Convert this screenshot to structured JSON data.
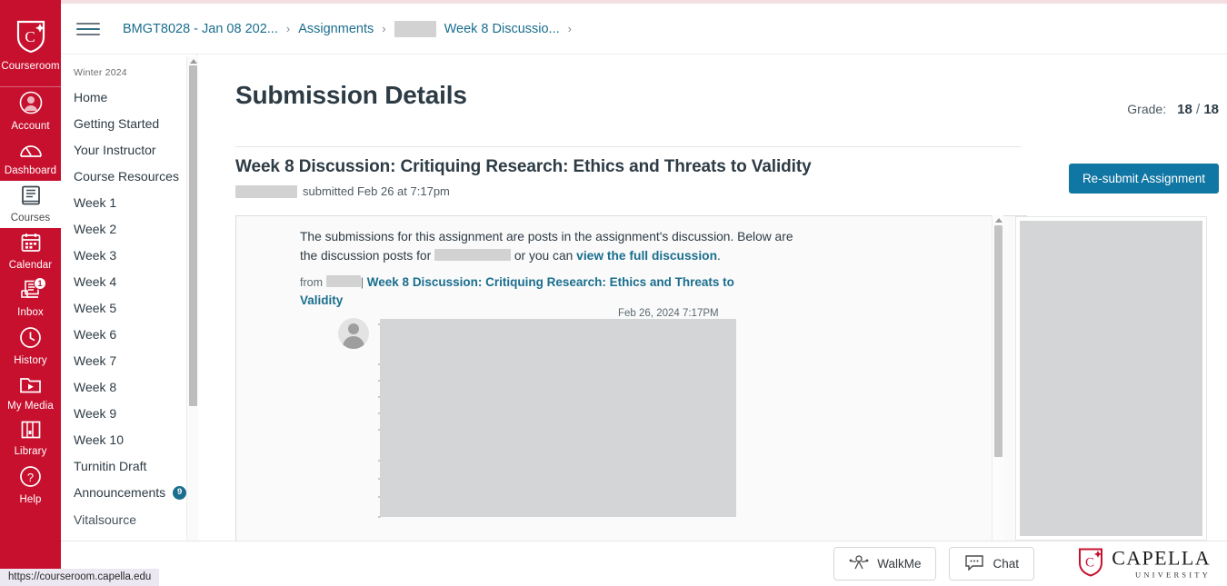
{
  "global_nav": {
    "brand": {
      "label": "Courseroom",
      "icon": "capella-shield-icon"
    },
    "items": [
      {
        "label": "Account",
        "icon": "account-avatar-icon",
        "active": false,
        "badge": ""
      },
      {
        "label": "Dashboard",
        "icon": "dashboard-gauge-icon",
        "active": false,
        "badge": ""
      },
      {
        "label": "Courses",
        "icon": "courses-book-icon",
        "active": true,
        "badge": ""
      },
      {
        "label": "Calendar",
        "icon": "calendar-icon",
        "active": false,
        "badge": ""
      },
      {
        "label": "Inbox",
        "icon": "inbox-tray-icon",
        "active": false,
        "badge": "1"
      },
      {
        "label": "History",
        "icon": "history-clock-icon",
        "active": false,
        "badge": ""
      },
      {
        "label": "My Media",
        "icon": "my-media-play-folder-icon",
        "active": false,
        "badge": ""
      },
      {
        "label": "Library",
        "icon": "library-books-icon",
        "active": false,
        "badge": ""
      },
      {
        "label": "Help",
        "icon": "help-question-icon",
        "active": false,
        "badge": ""
      }
    ]
  },
  "course_nav": {
    "term": "Winter 2024",
    "items": [
      {
        "label": "Home",
        "badge": ""
      },
      {
        "label": "Getting Started",
        "badge": ""
      },
      {
        "label": "Your Instructor",
        "badge": ""
      },
      {
        "label": "Course Resources",
        "badge": ""
      },
      {
        "label": "Week 1",
        "badge": ""
      },
      {
        "label": "Week 2",
        "badge": ""
      },
      {
        "label": "Week 3",
        "badge": ""
      },
      {
        "label": "Week 4",
        "badge": ""
      },
      {
        "label": "Week 5",
        "badge": ""
      },
      {
        "label": "Week 6",
        "badge": ""
      },
      {
        "label": "Week 7",
        "badge": ""
      },
      {
        "label": "Week 8",
        "badge": ""
      },
      {
        "label": "Week 9",
        "badge": ""
      },
      {
        "label": "Week 10",
        "badge": ""
      },
      {
        "label": "Turnitin Draft",
        "badge": ""
      },
      {
        "label": "Announcements",
        "badge": "9"
      },
      {
        "label": "Vitalsource",
        "badge": ""
      }
    ]
  },
  "header": {
    "menu_icon": "hamburger-icon",
    "breadcrumb": [
      {
        "label": "BMGT8028 - Jan 08 202...",
        "redacted": false
      },
      {
        "label": "Assignments",
        "redacted": false
      },
      {
        "label": "Week 8 Discussio...",
        "redacted": true
      }
    ],
    "separator": "›"
  },
  "main": {
    "page_title": "Submission Details",
    "grade_label": "Grade:",
    "grade_earned": "18",
    "grade_sep": "/",
    "grade_possible": "18",
    "assignment_title": "Week 8 Discussion: Critiquing Research: Ethics and Threats to Validity",
    "submitted_text": "submitted Feb 26 at 7:17pm",
    "resubmit_label": "Re-submit Assignment"
  },
  "discussion": {
    "intro_part1": "The submissions for this assignment are posts in the assignment's discussion. Below are the discussion posts for",
    "intro_part2": "or you can",
    "intro_link": "view the full discussion",
    "intro_end": ".",
    "from_label": "from",
    "pipe": "|",
    "topic_link": "Week 8 Discussion: Critiquing Research: Ethics and Threats to Validity",
    "post_date": "Feb 26, 2024 7:17PM",
    "avatar_icon": "user-avatar-icon"
  },
  "footer": {
    "walkme_label": "WalkMe",
    "walkme_icon": "walkme-icon",
    "chat_label": "Chat",
    "chat_icon": "chat-bubble-icon",
    "logo_name": "CAPELLA",
    "logo_sub": "UNIVERSITY",
    "logo_icon": "capella-shield-icon"
  },
  "status_bar": {
    "url": "https://courseroom.capella.edu"
  },
  "colors": {
    "brand_red": "#c7102e",
    "link_blue": "#1a6e8e",
    "button_blue": "#1076a4",
    "badge_blue": "#1a6e8e",
    "text_dark": "#2d3b45"
  }
}
